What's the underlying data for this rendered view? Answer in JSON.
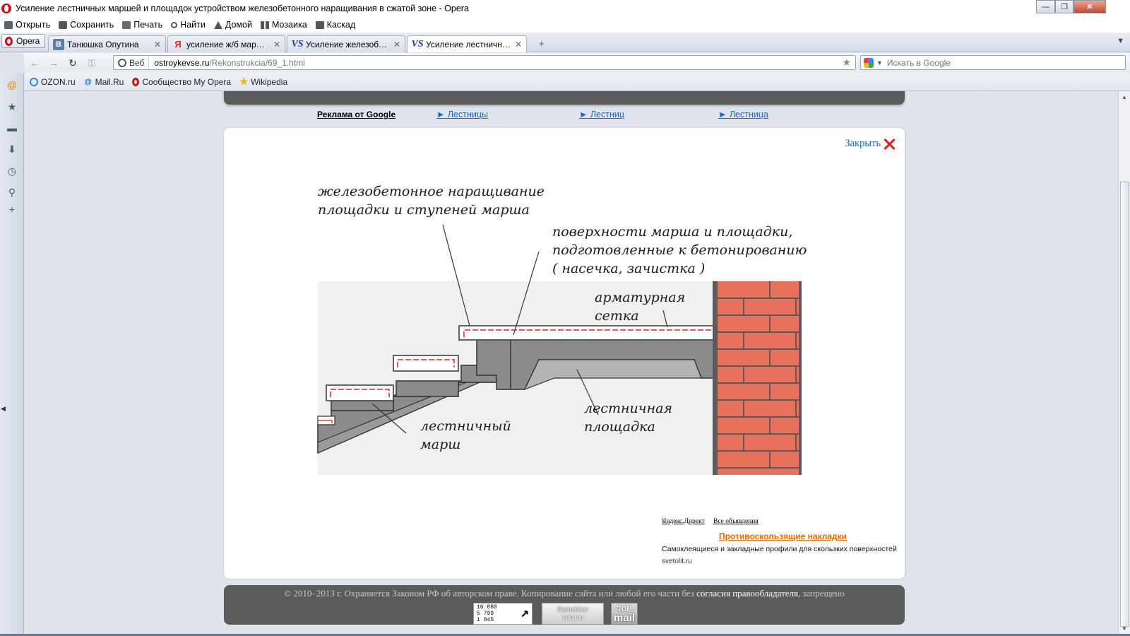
{
  "window": {
    "title": "Усиление лестничных маршей и площадок устройством железобетонного наращивания в сжатой зоне - Opera",
    "controls": [
      "—",
      "❐",
      "✕"
    ]
  },
  "menubar": {
    "items": [
      {
        "label": "Открыть",
        "icon": "folder-icon"
      },
      {
        "label": "Сохранить",
        "icon": "save-icon"
      },
      {
        "label": "Печать",
        "icon": "print-icon"
      },
      {
        "label": "Найти",
        "icon": "find-icon"
      },
      {
        "label": "Домой",
        "icon": "home-icon"
      },
      {
        "label": "Мозаика",
        "icon": "tile-icon"
      },
      {
        "label": "Каскад",
        "icon": "cascade-icon"
      }
    ]
  },
  "tabs": {
    "opera_button": "Opera",
    "items": [
      {
        "label": "Танюшка Опутина",
        "favicon": "В",
        "close": "✕"
      },
      {
        "label": "усиление ж/б марше...",
        "favicon": "Я",
        "close": "✕"
      },
      {
        "label": "Усиление железобето...",
        "favicon": "VS",
        "close": "✕"
      },
      {
        "label": "Усиление лестничных...",
        "favicon": "VS",
        "close": "✕",
        "active": true
      }
    ],
    "new_tab": "+",
    "dropdown": "▼"
  },
  "addressbar": {
    "back": "←",
    "forward": "→",
    "reload": "↻",
    "key": "⚿",
    "web_badge": "Веб",
    "url_host": "ostroykevse.ru",
    "url_path": "/Rekonstrukcia/69_1.html",
    "star": "★",
    "search_placeholder": "Искать в Google",
    "search_dropdown": "▼"
  },
  "bookmarks": {
    "items": [
      {
        "label": "OZON.ru",
        "icon": "ozon-icon"
      },
      {
        "label": "Mail.Ru",
        "icon": "mailru-icon",
        "glyph": "@"
      },
      {
        "label": "Сообщество My Opera",
        "icon": "opera-icon"
      },
      {
        "label": "Wikipedia",
        "icon": "star-icon",
        "glyph": "★"
      }
    ]
  },
  "sidepanel": {
    "icons": [
      {
        "name": "mail-panel-icon",
        "glyph": "@"
      },
      {
        "name": "bookmarks-panel-icon",
        "glyph": "★"
      },
      {
        "name": "notes-panel-icon",
        "glyph": "▬"
      },
      {
        "name": "downloads-panel-icon",
        "glyph": "⬇"
      },
      {
        "name": "history-panel-icon",
        "glyph": "◷"
      },
      {
        "name": "search-panel-icon",
        "glyph": "⚲"
      },
      {
        "name": "add-panel-icon",
        "glyph": "+"
      }
    ],
    "collapse_arrow": "◀"
  },
  "scrollbar": {
    "up": "▲",
    "down": "▼"
  },
  "ads": {
    "title": "Реклама от Google",
    "links": [
      "► Лестницы",
      "► Лестниц",
      "► Лестница"
    ]
  },
  "card": {
    "close_label": "Закрыть",
    "diagram": {
      "label_top": [
        "железобетонное наращивание",
        "площадки и ступеней марша"
      ],
      "label_surfaces": [
        "поверхности марша и площадки,",
        "подготовленные к бетонированию",
        "( насечка, зачистка )"
      ],
      "label_mesh": [
        "арматурная",
        "сетка"
      ],
      "label_flight": [
        "лестничный",
        "марш"
      ],
      "label_landing": [
        "лестничная",
        "площадка"
      ],
      "colors": {
        "background": "#f0f0f0",
        "concrete": "#8c8c8c",
        "concrete_light": "#b4b4b4",
        "mesh": "#e32020",
        "brick": "#e8725c",
        "mortar": "#5a5a5a"
      }
    },
    "direct": {
      "yandex_link": "Яндекс.Директ",
      "all_link": "Все объявления",
      "ad_title": "Противоскользящие накладки",
      "ad_text": "Самоклеящиеся и закладные профили для скользких поверхностей",
      "ad_domain": "svetolit.ru"
    }
  },
  "footer": {
    "text_before": "© 2010–2013 г. Охраняется Законом РФ об авторском праве. Копирование сайта или любой его части без ",
    "text_highlight": "согласия правообладателя",
    "text_after": ", запрещено",
    "counter_li": {
      "lines": [
        "16 080",
        "5 799",
        "1 045"
      ],
      "arrow": "↗"
    },
    "counter_rambler": {
      "name": "Rambler",
      "sub": "ТОП100"
    },
    "counter_top": {
      "line1": "TOP",
      "line2": "mail"
    }
  }
}
